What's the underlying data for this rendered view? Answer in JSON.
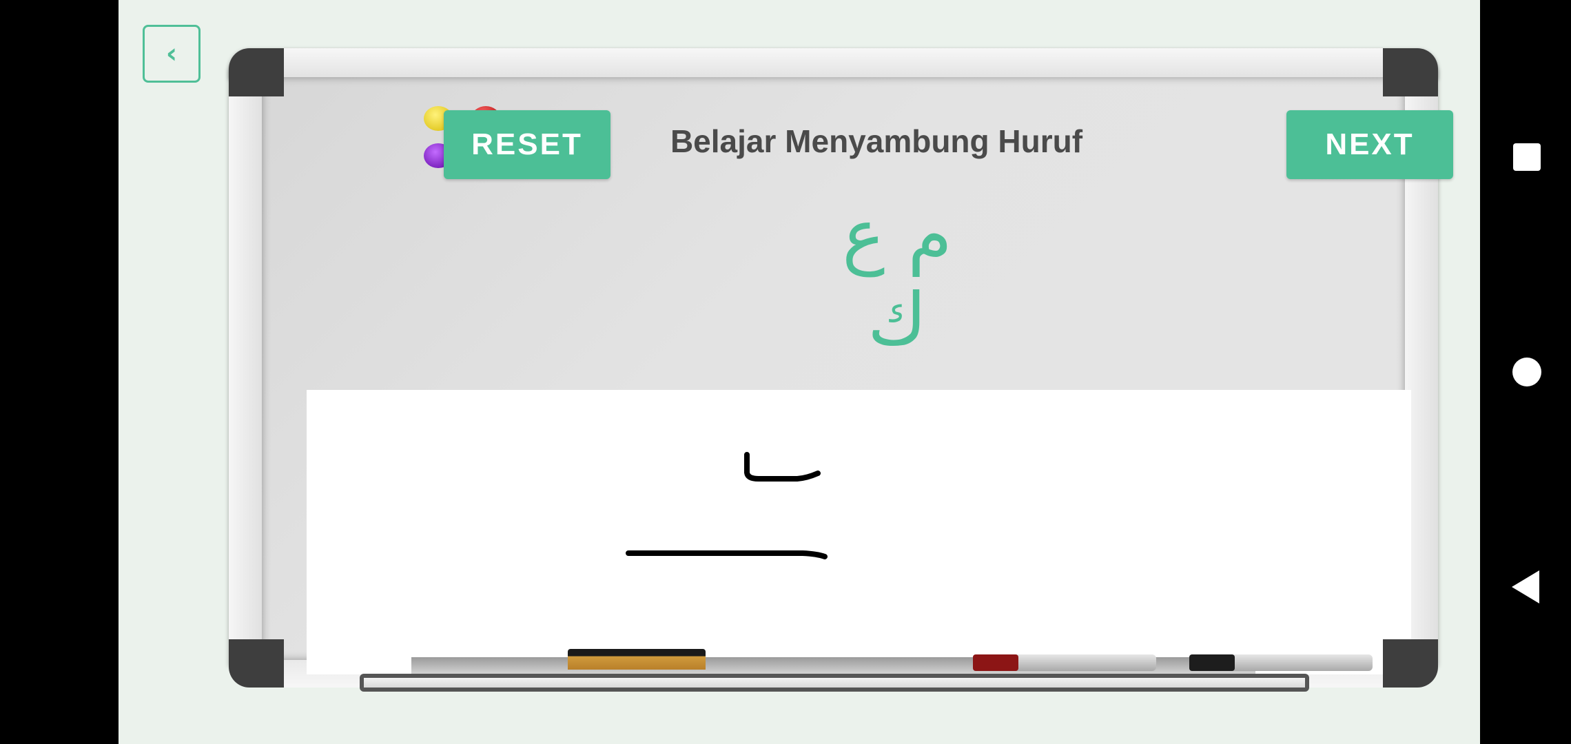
{
  "app": {
    "back_icon": "chevron-left-icon",
    "header": {
      "title": "Belajar Menyambung Huruf",
      "reset_label": "RESET",
      "next_label": "NEXT"
    },
    "prompt_letters": "م ع ك",
    "colors": {
      "accent": "#4cbf96",
      "title_text": "#4a4a4a",
      "background": "#ebf2ec",
      "ink": "#000000"
    },
    "magnets": [
      "yellow",
      "red",
      "purple"
    ]
  },
  "system_nav": {
    "recents_icon": "square-icon",
    "home_icon": "circle-icon",
    "back_icon": "triangle-back-icon"
  }
}
